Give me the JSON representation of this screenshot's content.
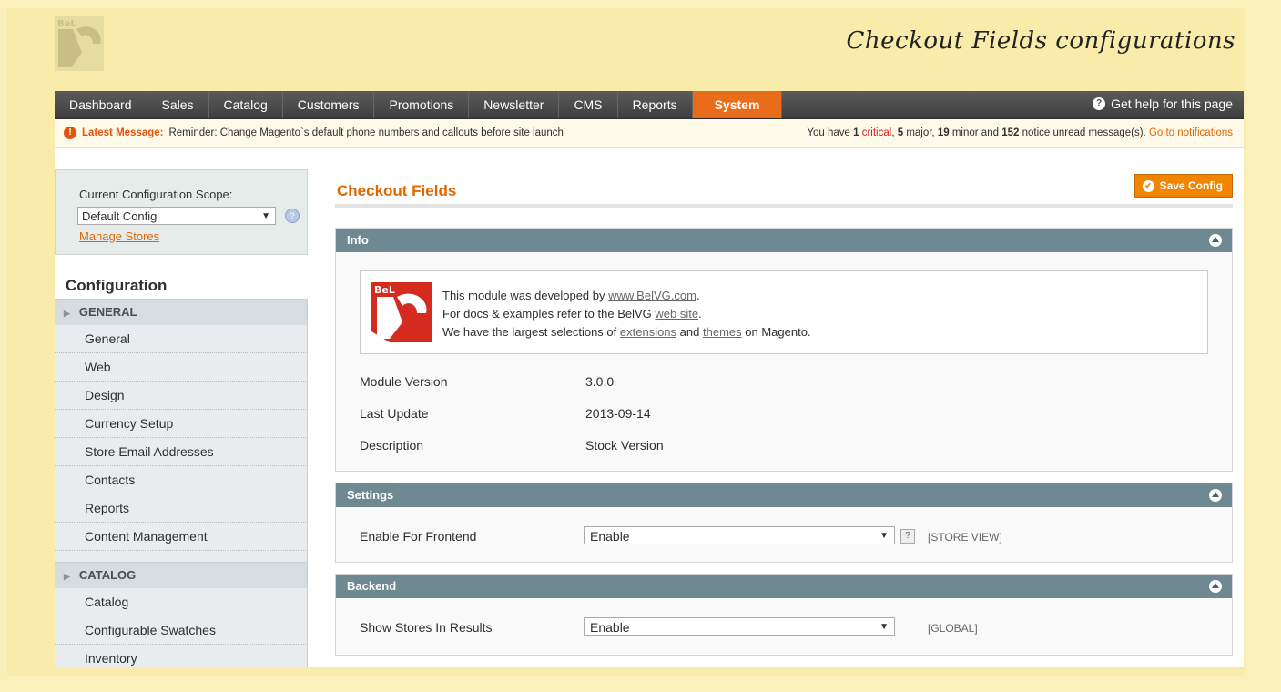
{
  "banner": {
    "title": "Checkout Fields configurations",
    "logo_icon": "belvg-logo"
  },
  "nav": {
    "items": [
      {
        "label": "Dashboard"
      },
      {
        "label": "Sales"
      },
      {
        "label": "Catalog"
      },
      {
        "label": "Customers"
      },
      {
        "label": "Promotions"
      },
      {
        "label": "Newsletter"
      },
      {
        "label": "CMS"
      },
      {
        "label": "Reports"
      },
      {
        "label": "System"
      }
    ],
    "active": "System",
    "help_label": "Get help for this page"
  },
  "message": {
    "label": "Latest Message:",
    "text": "Reminder: Change Magento`s default phone numbers and callouts before site launch",
    "prefix": "You have",
    "critical_count": "1",
    "critical_word": "critical",
    "major_count": "5",
    "major_word": "major,",
    "minor_count": "19",
    "minor_word": "minor and",
    "notice_count": "152",
    "notice_word": "notice unread message(s).",
    "link": "Go to notifications"
  },
  "sidebar": {
    "scope_label": "Current Configuration Scope:",
    "scope_value": "Default Config",
    "manage_stores": "Manage Stores",
    "heading": "Configuration",
    "groups": [
      {
        "title": "GENERAL",
        "items": [
          "General",
          "Web",
          "Design",
          "Currency Setup",
          "Store Email Addresses",
          "Contacts",
          "Reports",
          "Content Management"
        ]
      },
      {
        "title": "CATALOG",
        "items": [
          "Catalog",
          "Configurable Swatches",
          "Inventory"
        ]
      }
    ]
  },
  "main": {
    "title": "Checkout Fields",
    "save_label": "Save Config",
    "info": {
      "header": "Info",
      "line1_prefix": "This module was developed by",
      "line1_link": "www.BelVG.com",
      "line1_suffix": ".",
      "line2_prefix": "For docs & examples refer to the BelVG",
      "line2_link": "web site",
      "line2_suffix": ".",
      "line3_prefix": "We have the largest selections of",
      "line3_link1": "extensions",
      "line3_and": "and",
      "line3_link2": "themes",
      "line3_suffix": "on Magento.",
      "rows": [
        {
          "label": "Module Version",
          "value": "3.0.0"
        },
        {
          "label": "Last Update",
          "value": "2013-09-14"
        },
        {
          "label": "Description",
          "value": "Stock Version"
        }
      ]
    },
    "settings": {
      "header": "Settings",
      "field_label": "Enable For Frontend",
      "field_value": "Enable",
      "help": "?",
      "scope": "[STORE VIEW]"
    },
    "backend": {
      "header": "Backend",
      "field_label": "Show Stores In Results",
      "field_value": "Enable",
      "scope": "[GLOBAL]"
    }
  },
  "colors": {
    "accent": "#e26703",
    "nav_active": "#e86c1a",
    "section_header": "#6f8992",
    "banner_bg": "#faf0b9"
  }
}
